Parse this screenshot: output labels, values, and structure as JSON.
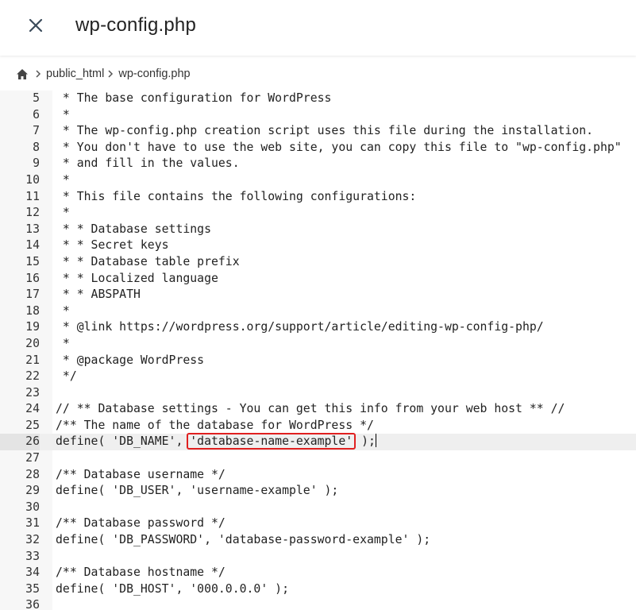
{
  "header": {
    "title": "wp-config.php",
    "close_icon": "close-icon"
  },
  "breadcrumb": {
    "home_icon": "home-icon",
    "items": [
      "public_html",
      "wp-config.php"
    ]
  },
  "editor": {
    "lines": [
      {
        "n": "5",
        "text": " * The base configuration for WordPress"
      },
      {
        "n": "6",
        "text": " *"
      },
      {
        "n": "7",
        "text": " * The wp-config.php creation script uses this file during the installation."
      },
      {
        "n": "8",
        "text": " * You don't have to use the web site, you can copy this file to \"wp-config.php\""
      },
      {
        "n": "9",
        "text": " * and fill in the values."
      },
      {
        "n": "10",
        "text": " *"
      },
      {
        "n": "11",
        "text": " * This file contains the following configurations:"
      },
      {
        "n": "12",
        "text": " *"
      },
      {
        "n": "13",
        "text": " * * Database settings"
      },
      {
        "n": "14",
        "text": " * * Secret keys"
      },
      {
        "n": "15",
        "text": " * * Database table prefix"
      },
      {
        "n": "16",
        "text": " * * Localized language"
      },
      {
        "n": "17",
        "text": " * * ABSPATH"
      },
      {
        "n": "18",
        "text": " *"
      },
      {
        "n": "19",
        "text": " * @link https://wordpress.org/support/article/editing-wp-config-php/"
      },
      {
        "n": "20",
        "text": " *"
      },
      {
        "n": "21",
        "text": " * @package WordPress"
      },
      {
        "n": "22",
        "text": " */"
      },
      {
        "n": "23",
        "text": ""
      },
      {
        "n": "24",
        "text": "// ** Database settings - You can get this info from your web host ** //"
      },
      {
        "n": "25",
        "text": "/** The name of the database for WordPress */"
      },
      {
        "n": "26",
        "text": "define( 'DB_NAME', ",
        "highlight": "'database-name-example'",
        "after": " );"
      },
      {
        "n": "27",
        "text": ""
      },
      {
        "n": "28",
        "text": "/** Database username */"
      },
      {
        "n": "29",
        "text": "define( 'DB_USER', 'username-example' );"
      },
      {
        "n": "30",
        "text": ""
      },
      {
        "n": "31",
        "text": "/** Database password */"
      },
      {
        "n": "32",
        "text": "define( 'DB_PASSWORD', 'database-password-example' );"
      },
      {
        "n": "33",
        "text": ""
      },
      {
        "n": "34",
        "text": "/** Database hostname */"
      },
      {
        "n": "35",
        "text": "define( 'DB_HOST', '000.0.0.0' );"
      },
      {
        "n": "36",
        "text": ""
      }
    ]
  },
  "colors": {
    "highlight_border": "#e02020",
    "gutter_bg": "#f7f7f7",
    "active_line_bg": "#efefef"
  }
}
